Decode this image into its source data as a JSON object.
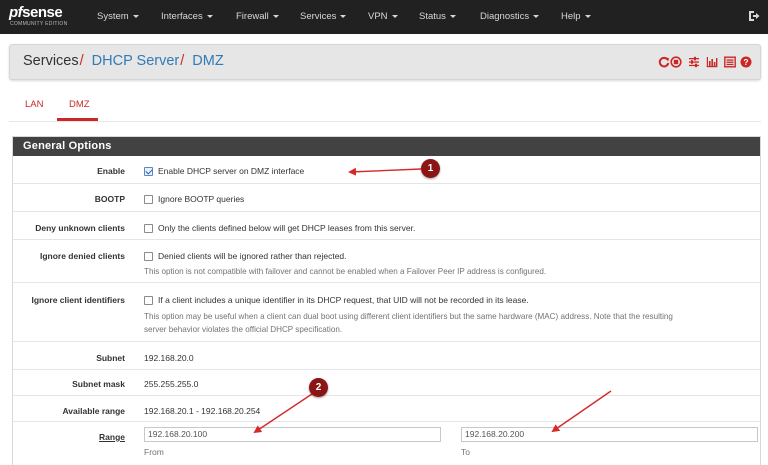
{
  "logo": {
    "main_prefix": "pf",
    "main_rest": "sense",
    "sub": "COMMUNITY EDITION"
  },
  "nav": [
    "System",
    "Interfaces",
    "Firewall",
    "Services",
    "VPN",
    "Status",
    "Diagnostics",
    "Help"
  ],
  "breadcrumb": {
    "part1": "Services",
    "part2": "DHCP Server",
    "part3": "DMZ",
    "separator": "/"
  },
  "header_icons": [
    "restart-service-icon",
    "stop-service-icon",
    "settings-sliders-icon",
    "status-chart-icon",
    "logs-list-icon",
    "help-icon"
  ],
  "tabs": [
    {
      "label": "LAN",
      "active": false
    },
    {
      "label": "DMZ",
      "active": true
    }
  ],
  "panel": {
    "title": "General Options",
    "enable": {
      "label": "Enable",
      "checkbox_label": "Enable DHCP server on DMZ interface",
      "checked": true
    },
    "bootp": {
      "label": "BOOTP",
      "checkbox_label": "Ignore BOOTP queries",
      "checked": false
    },
    "deny_unknown": {
      "label": "Deny unknown clients",
      "checkbox_label": "Only the clients defined below will get DHCP leases from this server.",
      "checked": false
    },
    "ignore_denied": {
      "label": "Ignore denied clients",
      "checkbox_label": "Denied clients will be ignored rather than rejected.",
      "help": "This option is not compatible with failover and cannot be enabled when a Failover Peer IP address is configured.",
      "checked": false
    },
    "ignore_ids": {
      "label": "Ignore client identifiers",
      "checkbox_label": "If a client includes a unique identifier in its DHCP request, that UID will not be recorded in its lease.",
      "help_line1": "This option may be useful when a client can dual boot using different client identifiers but the same hardware (MAC) address. Note that the resulting",
      "help_line2": "server behavior violates the official DHCP specification.",
      "checked": false
    },
    "subnet": {
      "label": "Subnet",
      "value": "192.168.20.0"
    },
    "subnet_mask": {
      "label": "Subnet mask",
      "value": "255.255.255.0"
    },
    "available_range": {
      "label": "Available range",
      "value": "192.168.20.1 - 192.168.20.254"
    },
    "range": {
      "label": "Range",
      "from_value": "192.168.20.100",
      "to_value": "192.168.20.200",
      "from_label": "From",
      "to_label": "To"
    }
  },
  "annotations": {
    "badge1": "1",
    "badge2": "2",
    "color": "#8b1515",
    "arrow_color": "#d42a2a"
  },
  "colors": {
    "navbar": "#212121",
    "accent_red": "#cc2727",
    "link_blue": "#337ab7",
    "panel_heading": "#424242"
  }
}
